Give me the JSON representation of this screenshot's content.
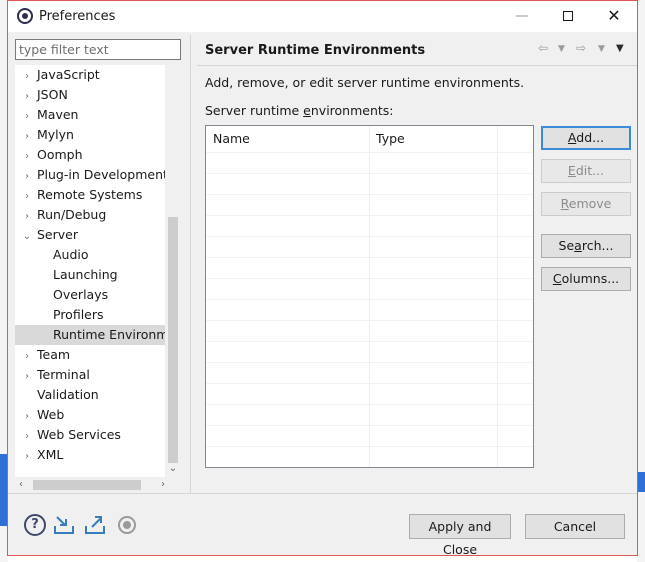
{
  "window": {
    "title": "Preferences",
    "minimize_glyph": "—",
    "close_glyph": "✕"
  },
  "filter": {
    "placeholder": "type filter text",
    "value": ""
  },
  "tree": {
    "items": [
      {
        "label": "JavaScript",
        "expanded": false
      },
      {
        "label": "JSON",
        "expanded": false
      },
      {
        "label": "Maven",
        "expanded": false
      },
      {
        "label": "Mylyn",
        "expanded": false
      },
      {
        "label": "Oomph",
        "expanded": false
      },
      {
        "label": "Plug-in Development",
        "expanded": false
      },
      {
        "label": "Remote Systems",
        "expanded": false
      },
      {
        "label": "Run/Debug",
        "expanded": false
      },
      {
        "label": "Server",
        "expanded": true
      },
      {
        "label": "Audio",
        "child": true
      },
      {
        "label": "Launching",
        "child": true
      },
      {
        "label": "Overlays",
        "child": true
      },
      {
        "label": "Profilers",
        "child": true
      },
      {
        "label": "Runtime Environme",
        "child": true,
        "selected": true
      },
      {
        "label": "Team",
        "expanded": false
      },
      {
        "label": "Terminal",
        "expanded": false
      },
      {
        "label": "Validation",
        "leaf": true
      },
      {
        "label": "Web",
        "expanded": false
      },
      {
        "label": "Web Services",
        "expanded": false
      },
      {
        "label": "XML",
        "expanded": false
      }
    ],
    "arrow_collapsed": "›",
    "arrow_expanded": "⌄"
  },
  "page": {
    "title": "Server Runtime Environments",
    "description": "Add, remove, or edit server runtime environments.",
    "table_label_pre": "Server runtime ",
    "table_label_key": "e",
    "table_label_post": "nvironments:",
    "columns": [
      "Name",
      "Type"
    ]
  },
  "buttons": {
    "add": {
      "key": "A",
      "rest": "dd..."
    },
    "edit": {
      "key": "E",
      "rest": "dit..."
    },
    "remove": {
      "key": "R",
      "rest": "emove"
    },
    "search": {
      "pre": "Se",
      "key": "a",
      "rest": "rch..."
    },
    "columns": {
      "key": "C",
      "rest": "olumns..."
    }
  },
  "footer": {
    "help_glyph": "?",
    "apply_close": "Apply and Close",
    "cancel": "Cancel"
  },
  "colors": {
    "window_border": "#e05656",
    "focus_border": "#3c8ad8",
    "selection": "#d9d9d9"
  }
}
